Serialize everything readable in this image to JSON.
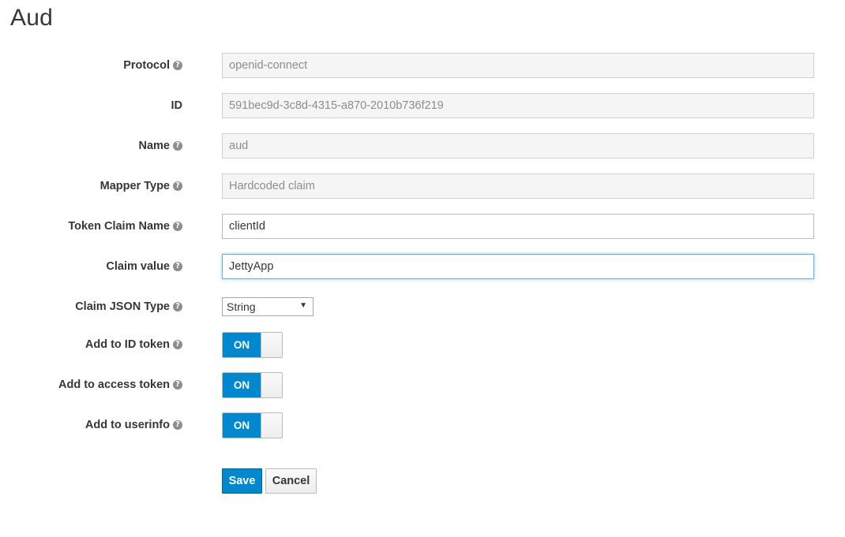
{
  "page": {
    "title": "Aud"
  },
  "form": {
    "protocol": {
      "label": "Protocol",
      "value": "openid-connect"
    },
    "id": {
      "label": "ID",
      "value": "591bec9d-3c8d-4315-a870-2010b736f219"
    },
    "name": {
      "label": "Name",
      "value": "aud"
    },
    "mapper_type": {
      "label": "Mapper Type",
      "value": "Hardcoded claim"
    },
    "token_claim_name": {
      "label": "Token Claim Name",
      "value": "clientId"
    },
    "claim_value": {
      "label": "Claim value",
      "value": "JettyApp"
    },
    "claim_json_type": {
      "label": "Claim JSON Type",
      "selected": "String"
    },
    "add_to_id_token": {
      "label": "Add to ID token",
      "state": "ON"
    },
    "add_to_access_token": {
      "label": "Add to access token",
      "state": "ON"
    },
    "add_to_userinfo": {
      "label": "Add to userinfo",
      "state": "ON"
    }
  },
  "icons": {
    "help": "?",
    "dropdown": "▼"
  },
  "buttons": {
    "save": "Save",
    "cancel": "Cancel"
  },
  "colors": {
    "primary": "#0088ce",
    "readonly_bg": "#f5f5f5",
    "focus_border": "#66afe9"
  }
}
